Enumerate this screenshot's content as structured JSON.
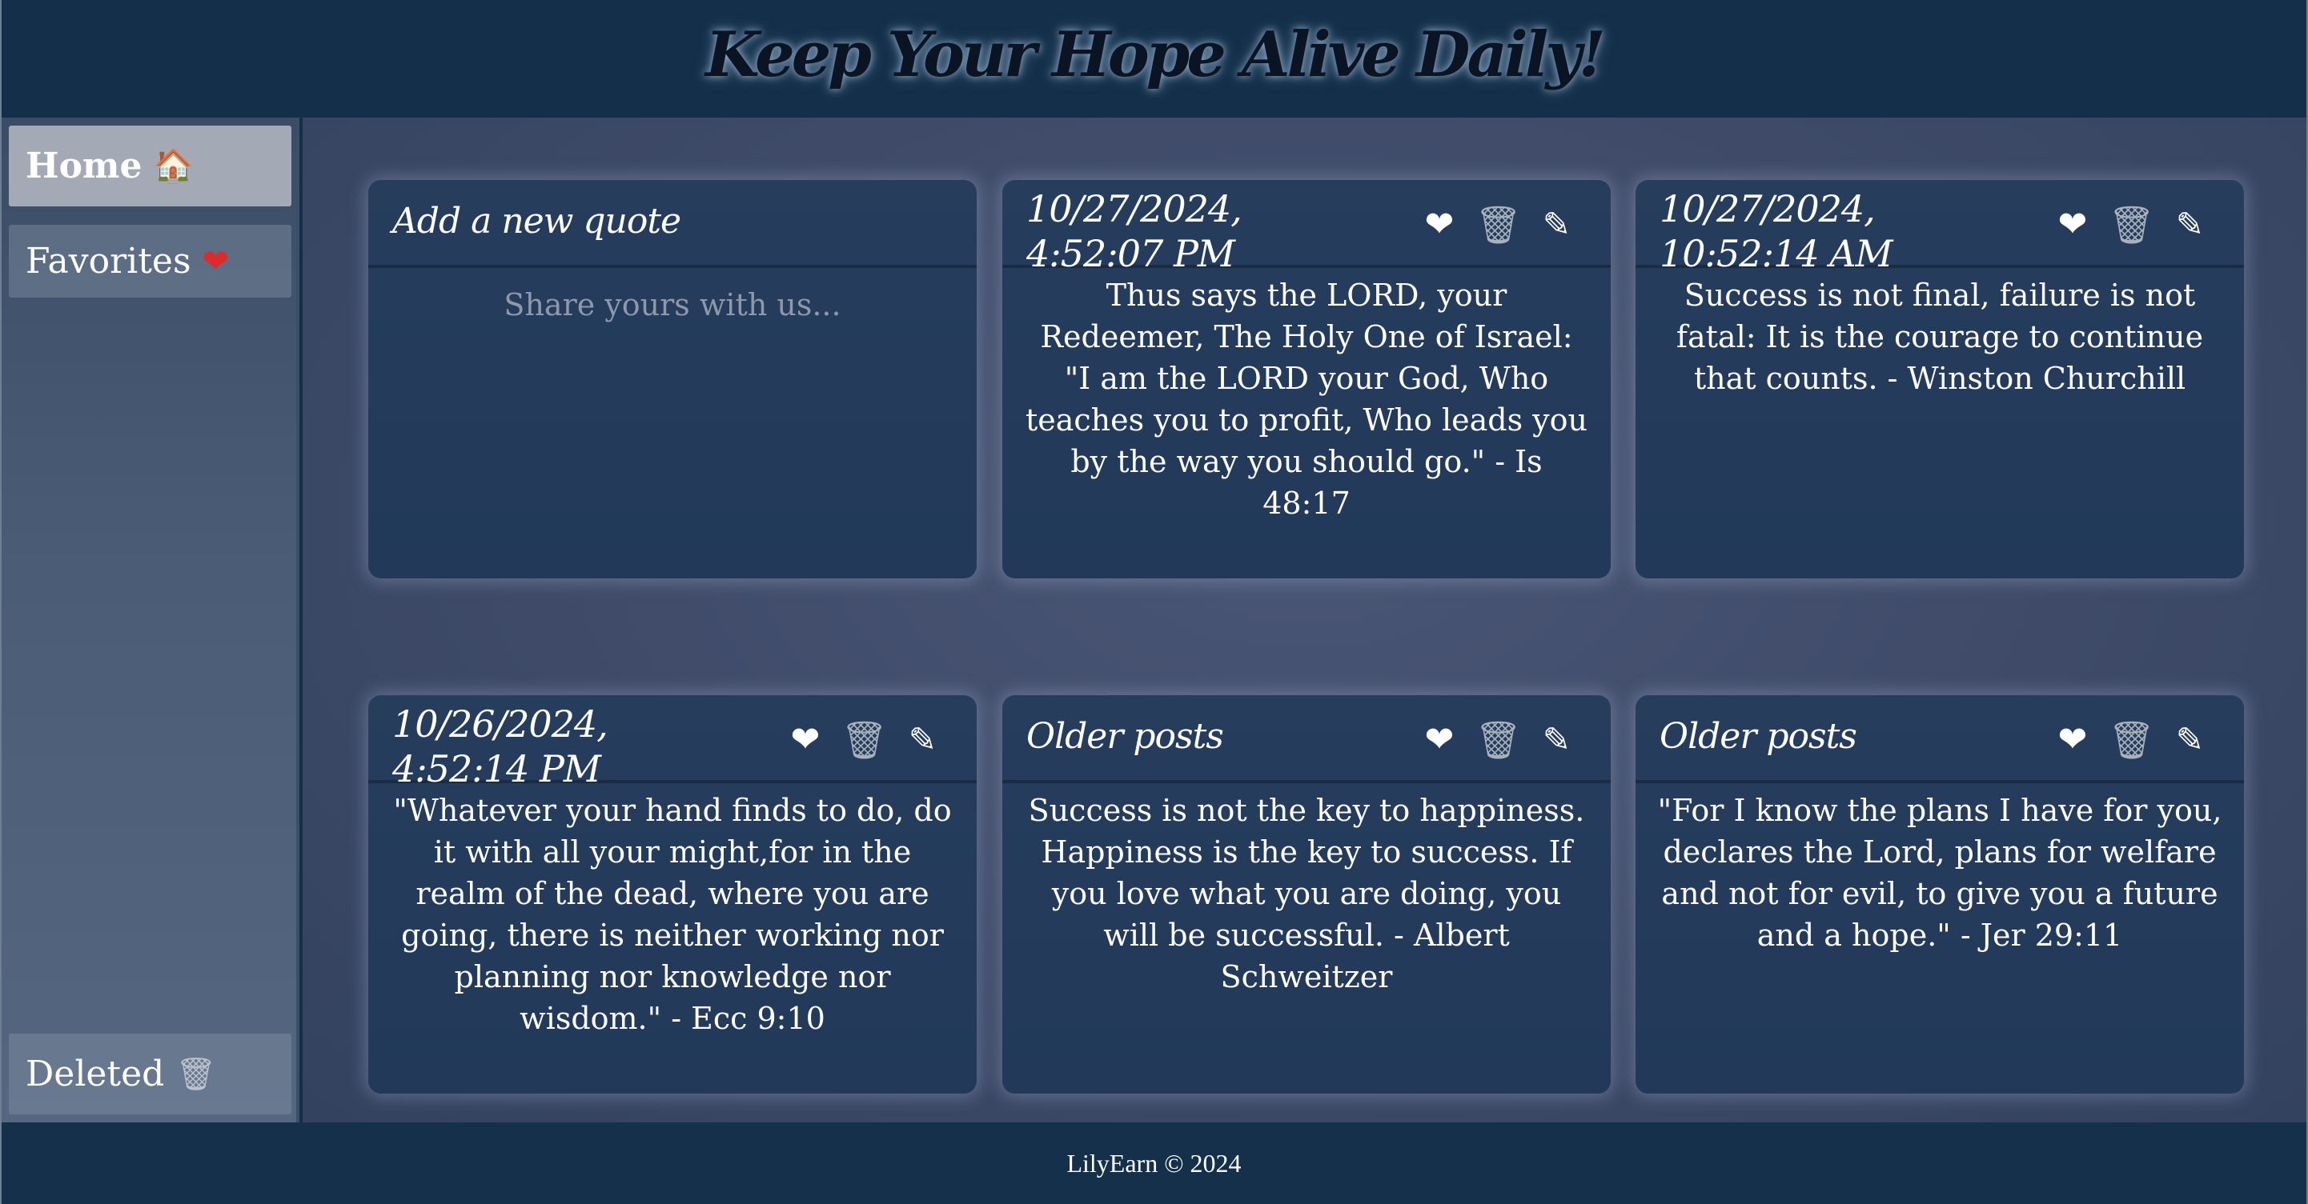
{
  "header": {
    "title": "Keep Your Hope Alive Daily!"
  },
  "sidebar": {
    "items": [
      {
        "label": "Home",
        "icon": "house-icon",
        "emoji": "🏠",
        "active": true
      },
      {
        "label": "Favorites",
        "icon": "heart-icon",
        "emoji": "❤",
        "active": false
      },
      {
        "label": "Deleted",
        "icon": "trash-icon",
        "emoji": "🗑",
        "active": false
      }
    ]
  },
  "new_quote": {
    "title": "Add a new quote",
    "placeholder": "Share yours with us..."
  },
  "icons": {
    "favorite": "❤",
    "delete": "🗑",
    "edit": "✎"
  },
  "quotes": [
    {
      "heading": "10/27/2024, 4:52:07 PM",
      "text": "Thus says the LORD, your Redeemer, The Holy One of Israel: \"I am the LORD your God, Who teaches you to profit, Who leads you by the way you should go.\" - Is 48:17"
    },
    {
      "heading": "10/27/2024, 10:52:14 AM",
      "text": "Success is not final, failure is not fatal: It is the courage to continue that counts. - Winston Churchill"
    },
    {
      "heading": "10/26/2024, 4:52:14 PM",
      "text": "\"Whatever your hand finds to do, do it with all your might,for in the realm of the dead, where you are going, there is neither working nor planning nor knowledge nor wisdom.\" - Ecc 9:10"
    },
    {
      "heading": "Older posts",
      "text": "Success is not the key to happiness. Happiness is the key to success. If you love what you are doing, you will be successful. - Albert Schweitzer"
    },
    {
      "heading": "Older posts",
      "text": "\"For I know the plans I have for you, declares the Lord, plans for welfare and not for evil, to give you a future and a hope.\" - Jer 29:11"
    }
  ],
  "colors": {
    "background": "#162e47",
    "card": "#22395a",
    "accent_heart": "#e02a2a"
  },
  "footer": {
    "text": "LilyEarn © 2024"
  }
}
